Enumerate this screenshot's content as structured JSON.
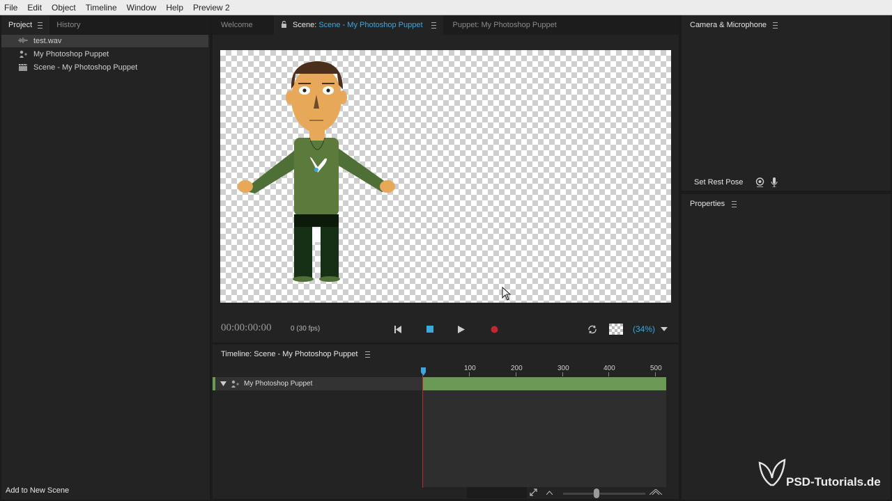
{
  "menu": [
    "File",
    "Edit",
    "Object",
    "Timeline",
    "Window",
    "Help",
    "Preview 2"
  ],
  "project_panel": {
    "tabs": [
      "Project",
      "History"
    ],
    "items": [
      {
        "label": "test.wav",
        "icon": "audio-waveform-icon"
      },
      {
        "label": "My Photoshop Puppet",
        "icon": "puppet-icon"
      },
      {
        "label": "Scene - My Photoshop Puppet",
        "icon": "scene-clapper-icon"
      }
    ],
    "add_to_scene": "Add to New Scene"
  },
  "center_tabs": {
    "welcome": "Welcome",
    "scene_prefix": "Scene:",
    "scene_name": "Scene - My Photoshop Puppet",
    "puppet": "Puppet: My Photoshop Puppet"
  },
  "transport": {
    "timecode": "00:00:00:00",
    "frame": "0 (30 fps)",
    "zoom": "(34%)"
  },
  "timeline": {
    "title": "Timeline: Scene - My Photoshop Puppet",
    "ruler": [
      "100",
      "200",
      "300",
      "400",
      "500"
    ],
    "track_label": "My Photoshop Puppet"
  },
  "camera_panel": {
    "title": "Camera & Microphone",
    "set_rest_pose": "Set Rest Pose"
  },
  "properties_panel": {
    "title": "Properties"
  },
  "watermark": "PSD-Tutorials.de",
  "colors": {
    "accent": "#3fa7de",
    "track_green": "#6a9a55",
    "record_red": "#c0282f"
  }
}
